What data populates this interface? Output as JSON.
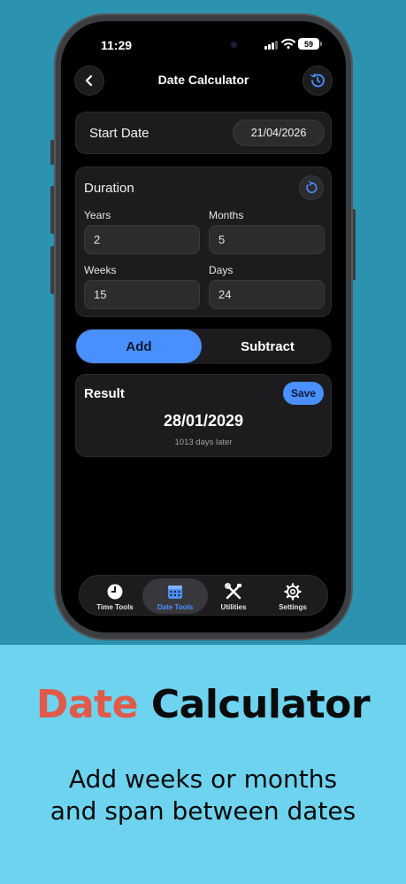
{
  "status_bar": {
    "time": "11:29",
    "battery": "59"
  },
  "nav": {
    "title": "Date Calculator",
    "back_icon": "chevron-left-icon",
    "history_icon": "history-clock-icon"
  },
  "start_date": {
    "label": "Start Date",
    "value": "21/04/2026"
  },
  "duration": {
    "title": "Duration",
    "reset_icon": "reset-icon",
    "years": {
      "label": "Years",
      "value": "2"
    },
    "months": {
      "label": "Months",
      "value": "5"
    },
    "weeks": {
      "label": "Weeks",
      "value": "15"
    },
    "days": {
      "label": "Days",
      "value": "24"
    }
  },
  "operation": {
    "add": "Add",
    "subtract": "Subtract",
    "selected": "Add"
  },
  "result": {
    "title": "Result",
    "save": "Save",
    "date": "28/01/2029",
    "note": "1013 days later"
  },
  "tabs": [
    {
      "label": "Time Tools",
      "icon": "clock-icon"
    },
    {
      "label": "Date Tools",
      "icon": "calendar-icon",
      "active": true
    },
    {
      "label": "Utilities",
      "icon": "tools-icon"
    },
    {
      "label": "Settings",
      "icon": "gear-icon"
    }
  ],
  "promo": {
    "title_accent": "Date",
    "title_main": "Calculator",
    "subtitle_line1": "Add weeks or months",
    "subtitle_line2": "and span between dates"
  },
  "colors": {
    "accent_blue": "#4a8fff",
    "title_accent": "#e05a4a",
    "top_background": "#2b93b0",
    "bottom_background": "#6dd3ef"
  }
}
